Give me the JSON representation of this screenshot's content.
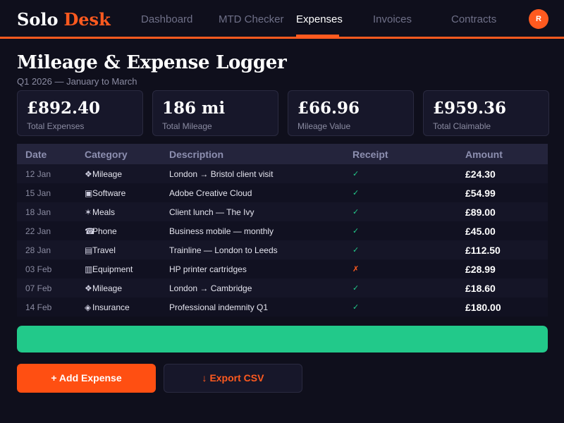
{
  "brand": {
    "part1": "Solo",
    "part2": "Desk"
  },
  "nav": {
    "items": [
      {
        "label": "Dashboard"
      },
      {
        "label": "MTD Checker"
      },
      {
        "label": "Expenses",
        "active": true
      },
      {
        "label": "Invoices"
      },
      {
        "label": "Contracts"
      }
    ],
    "avatar_initial": "R"
  },
  "page": {
    "title": "Mileage & Expense Logger",
    "subtitle": "Q1 2026 — January to March"
  },
  "stats": [
    {
      "value": "£892.40",
      "label": "Total Expenses"
    },
    {
      "value": "186 mi",
      "label": "Total Mileage"
    },
    {
      "value": "£66.96",
      "label": "Mileage Value"
    },
    {
      "value": "£959.36",
      "label": "Total Claimable"
    }
  ],
  "table": {
    "headers": {
      "date": "Date",
      "category": "Category",
      "description": "Description",
      "receipt": "Receipt",
      "amount": "Amount"
    },
    "rows": [
      {
        "date": "12 Jan",
        "category_icon": "car-icon",
        "category": "Mileage",
        "description": "London → Bristol client visit",
        "receipt": "check-icon",
        "amount": "£24.30"
      },
      {
        "date": "15 Jan",
        "category_icon": "laptop-icon",
        "category": "Software",
        "description": "Adobe Creative Cloud",
        "receipt": "check-icon",
        "amount": "£54.99"
      },
      {
        "date": "18 Jan",
        "category_icon": "fork-knife-icon",
        "category": "Meals",
        "description": "Client lunch — The Ivy",
        "receipt": "check-icon",
        "amount": "£89.00"
      },
      {
        "date": "22 Jan",
        "category_icon": "phone-icon",
        "category": "Phone",
        "description": "Business mobile — monthly",
        "receipt": "check-icon",
        "amount": "£45.00"
      },
      {
        "date": "28 Jan",
        "category_icon": "train-icon",
        "category": "Travel",
        "description": "Trainline — London to Leeds",
        "receipt": "check-icon",
        "amount": "£112.50"
      },
      {
        "date": "03 Feb",
        "category_icon": "printer-icon",
        "category": "Equipment",
        "description": "HP printer cartridges",
        "receipt": "cross-icon",
        "amount": "£28.99"
      },
      {
        "date": "07 Feb",
        "category_icon": "car-icon",
        "category": "Mileage",
        "description": "London → Cambridge",
        "receipt": "check-icon",
        "amount": "£18.60"
      },
      {
        "date": "14 Feb",
        "category_icon": "shield-icon",
        "category": "Insurance",
        "description": "Professional indemnity Q1",
        "receipt": "check-icon",
        "amount": "£180.00"
      }
    ]
  },
  "progress": {
    "value_percent": 100,
    "color": "#22c98a"
  },
  "buttons": {
    "add": "+ Add Expense",
    "export_icon": "download-icon",
    "export": "Export CSV"
  },
  "colors": {
    "accent": "#ff5a1f",
    "success": "#22c98a",
    "background": "#0f0f1c",
    "card": "#17172a"
  }
}
